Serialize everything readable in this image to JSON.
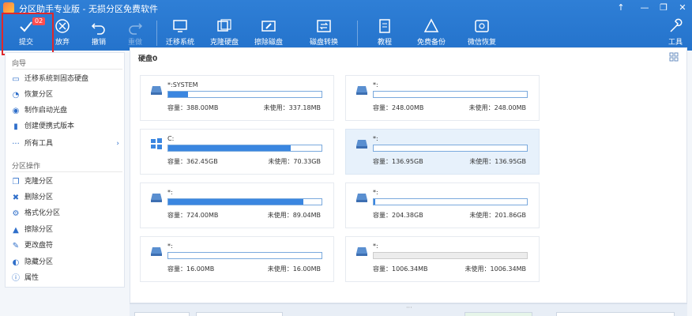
{
  "window": {
    "title": "分区助手专业版 - 无损分区免费软件",
    "controls": [
      "↑",
      "—",
      "❐",
      "✕"
    ]
  },
  "toolbar": {
    "badge": "02",
    "buttons": [
      {
        "label": "提交",
        "icon": "check-icon",
        "enabled": true
      },
      {
        "label": "放弃",
        "icon": "discard-icon",
        "enabled": true
      },
      {
        "label": "撤销",
        "icon": "undo-icon",
        "enabled": true
      },
      {
        "label": "重做",
        "icon": "redo-icon",
        "enabled": false
      },
      {
        "label": "迁移系统",
        "icon": "migrate-os-icon",
        "enabled": true
      },
      {
        "label": "克隆硬盘",
        "icon": "clone-disk-icon",
        "enabled": true
      },
      {
        "label": "擦除磁盘",
        "icon": "wipe-disk-icon",
        "enabled": true
      },
      {
        "label": "磁盘转换",
        "icon": "disk-convert-icon",
        "enabled": true
      },
      {
        "label": "教程",
        "icon": "tutorial-icon",
        "enabled": true
      },
      {
        "label": "免费备份",
        "icon": "backup-icon",
        "enabled": true
      },
      {
        "label": "微信恢复",
        "icon": "wechat-recover-icon",
        "enabled": true
      },
      {
        "label": "工具",
        "icon": "tools-icon",
        "enabled": true
      }
    ]
  },
  "sidebar": {
    "wizard_title": "向导",
    "wizard_items": [
      {
        "label": "迁移系统到固态硬盘",
        "icon": "monitor-icon"
      },
      {
        "label": "恢复分区",
        "icon": "recover-icon"
      },
      {
        "label": "制作启动光盘",
        "icon": "disc-icon"
      },
      {
        "label": "创建便携式版本",
        "icon": "portable-icon"
      },
      {
        "label": "所有工具",
        "icon": "more-dots-icon"
      }
    ],
    "ops_title": "分区操作",
    "ops_items": [
      {
        "label": "克隆分区",
        "icon": "clone-icon"
      },
      {
        "label": "删除分区",
        "icon": "delete-icon"
      },
      {
        "label": "格式化分区",
        "icon": "format-icon"
      },
      {
        "label": "擦除分区",
        "icon": "wipe-icon"
      },
      {
        "label": "更改盘符",
        "icon": "pencil-icon"
      },
      {
        "label": "隐藏分区",
        "icon": "hide-icon"
      },
      {
        "label": "属性",
        "icon": "info-icon"
      }
    ]
  },
  "main": {
    "disk_title": "硬盘0",
    "partitions": [
      {
        "name": "*:SYSTEM",
        "capacity": "容量：388.00MB",
        "free": "未使用：337.18MB",
        "used_fraction": 0.13,
        "os": false,
        "selected": false
      },
      {
        "name": "*:",
        "capacity": "容量：248.00MB",
        "free": "未使用：248.00MB",
        "used_fraction": 0.0,
        "os": false,
        "selected": false
      },
      {
        "name": "C:",
        "capacity": "容量：362.45GB",
        "free": "未使用：70.33GB",
        "used_fraction": 0.8,
        "os": true,
        "selected": false
      },
      {
        "name": "*:",
        "capacity": "容量：136.95GB",
        "free": "未使用：136.95GB",
        "used_fraction": 0.0,
        "os": false,
        "selected": true
      },
      {
        "name": "*:",
        "capacity": "容量：724.00MB",
        "free": "未使用：89.04MB",
        "used_fraction": 0.88,
        "os": false,
        "selected": false
      },
      {
        "name": "*:",
        "capacity": "容量：204.38GB",
        "free": "未使用：201.86GB",
        "used_fraction": 0.012,
        "os": false,
        "selected": false
      },
      {
        "name": "*:",
        "capacity": "容量：16.00MB",
        "free": "未使用：16.00MB",
        "used_fraction": 0.0,
        "os": false,
        "selected": false
      },
      {
        "name": "*:",
        "capacity": "容量：1006.34MB",
        "free": "未使用：1006.34MB",
        "used_fraction": 0.0,
        "os": false,
        "selected": false,
        "grey": true
      }
    ]
  },
  "colors": {
    "toolbar_bg": "#2473cc",
    "bar_fill": "#3a86e0",
    "highlight": "#e0282a",
    "selected_card": "#e7f1fb"
  }
}
